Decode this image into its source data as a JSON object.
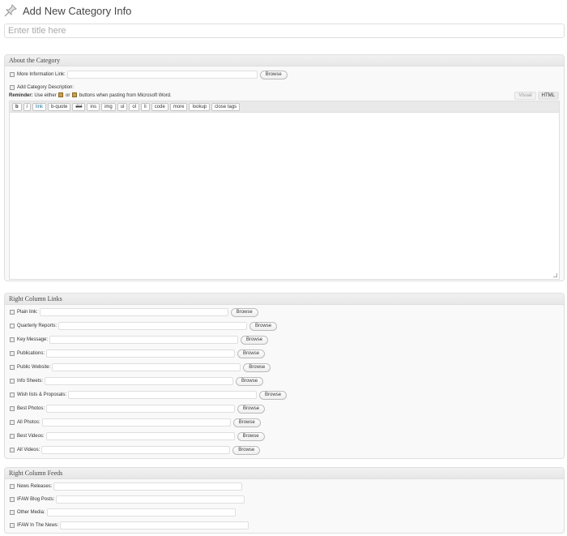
{
  "header": {
    "title": "Add New Category Info",
    "icon": "pushpin-icon"
  },
  "title_input": {
    "placeholder": "Enter title here"
  },
  "about": {
    "heading": "About the Category",
    "more_info_label": "More Information Link:",
    "browse_label": "Browse",
    "description_label": "Add Category Description:",
    "reminder_bold": "Reminder:",
    "reminder_part1": "Use either",
    "reminder_or": "or",
    "reminder_part2": "buttons when pasting from Microsoft Word.",
    "tab_visual": "Visual",
    "tab_html": "HTML",
    "quicktags": [
      "b",
      "i",
      "link",
      "b-quote",
      "del",
      "ins",
      "img",
      "ul",
      "ol",
      "li",
      "code",
      "more",
      "lookup",
      "close tags"
    ]
  },
  "links": {
    "heading": "Right Column Links",
    "browse_label": "Browse",
    "items": [
      "Plain link:",
      "Quarterly Reports:",
      "Key Message:",
      "Publications:",
      "Public Website:",
      "Info Sheets:",
      "Wish lists & Proposals:",
      "Best Photos:",
      "All Photos:",
      "Best Videos:",
      "All Videos:"
    ]
  },
  "feeds": {
    "heading": "Right Column Feeds",
    "items": [
      "News Releases:",
      "IFAW Blog Posts:",
      "Other Media:",
      "IFAW In The News:"
    ]
  }
}
